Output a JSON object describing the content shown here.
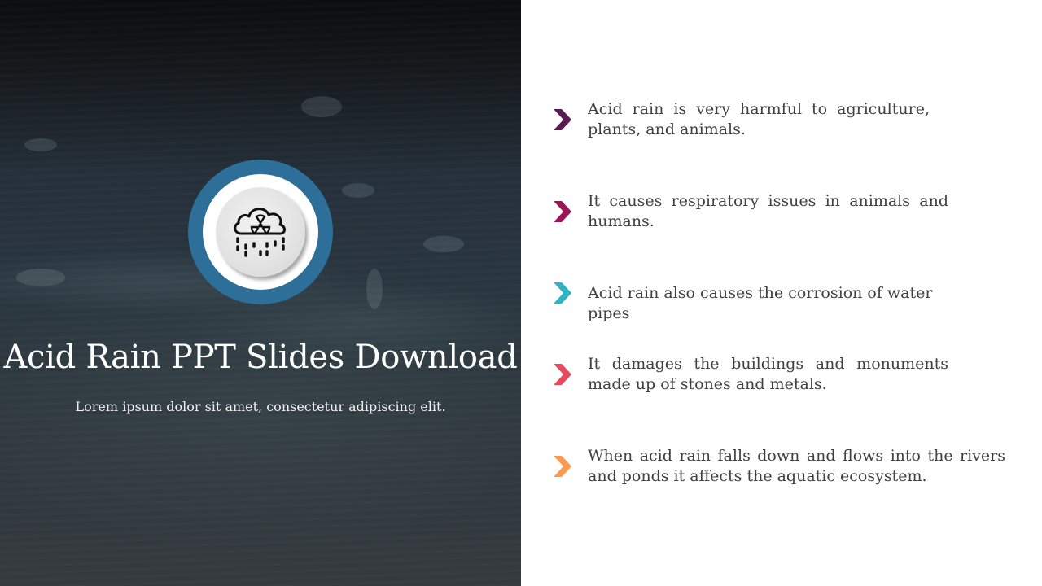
{
  "slide": {
    "title": "Acid Rain PPT Slides Download",
    "subtitle": "Lorem ipsum dolor sit amet, consectetur adipiscing elit.",
    "hero_icon": "acid-rain-cloud-icon",
    "ring_color": "#2d6f99"
  },
  "points": [
    {
      "text": "Acid rain is very harmful to agriculture, plants, and animals.",
      "color": "#5a1a52",
      "icon": "chevron-right-icon"
    },
    {
      "text": "It causes respiratory issues in animals and humans.",
      "color": "#9b1654",
      "icon": "chevron-right-icon"
    },
    {
      "text": "Acid rain also causes the corrosion of water pipes",
      "color": "#2fb3c1",
      "icon": "chevron-right-icon"
    },
    {
      "text": "It damages the buildings and monuments made up of stones and metals.",
      "color": "#e54b5c",
      "icon": "chevron-right-icon"
    },
    {
      "text": "When acid rain falls down and flows into the rivers and ponds it affects the aquatic ecosystem.",
      "color": "#fb9a50",
      "icon": "chevron-right-icon"
    }
  ]
}
